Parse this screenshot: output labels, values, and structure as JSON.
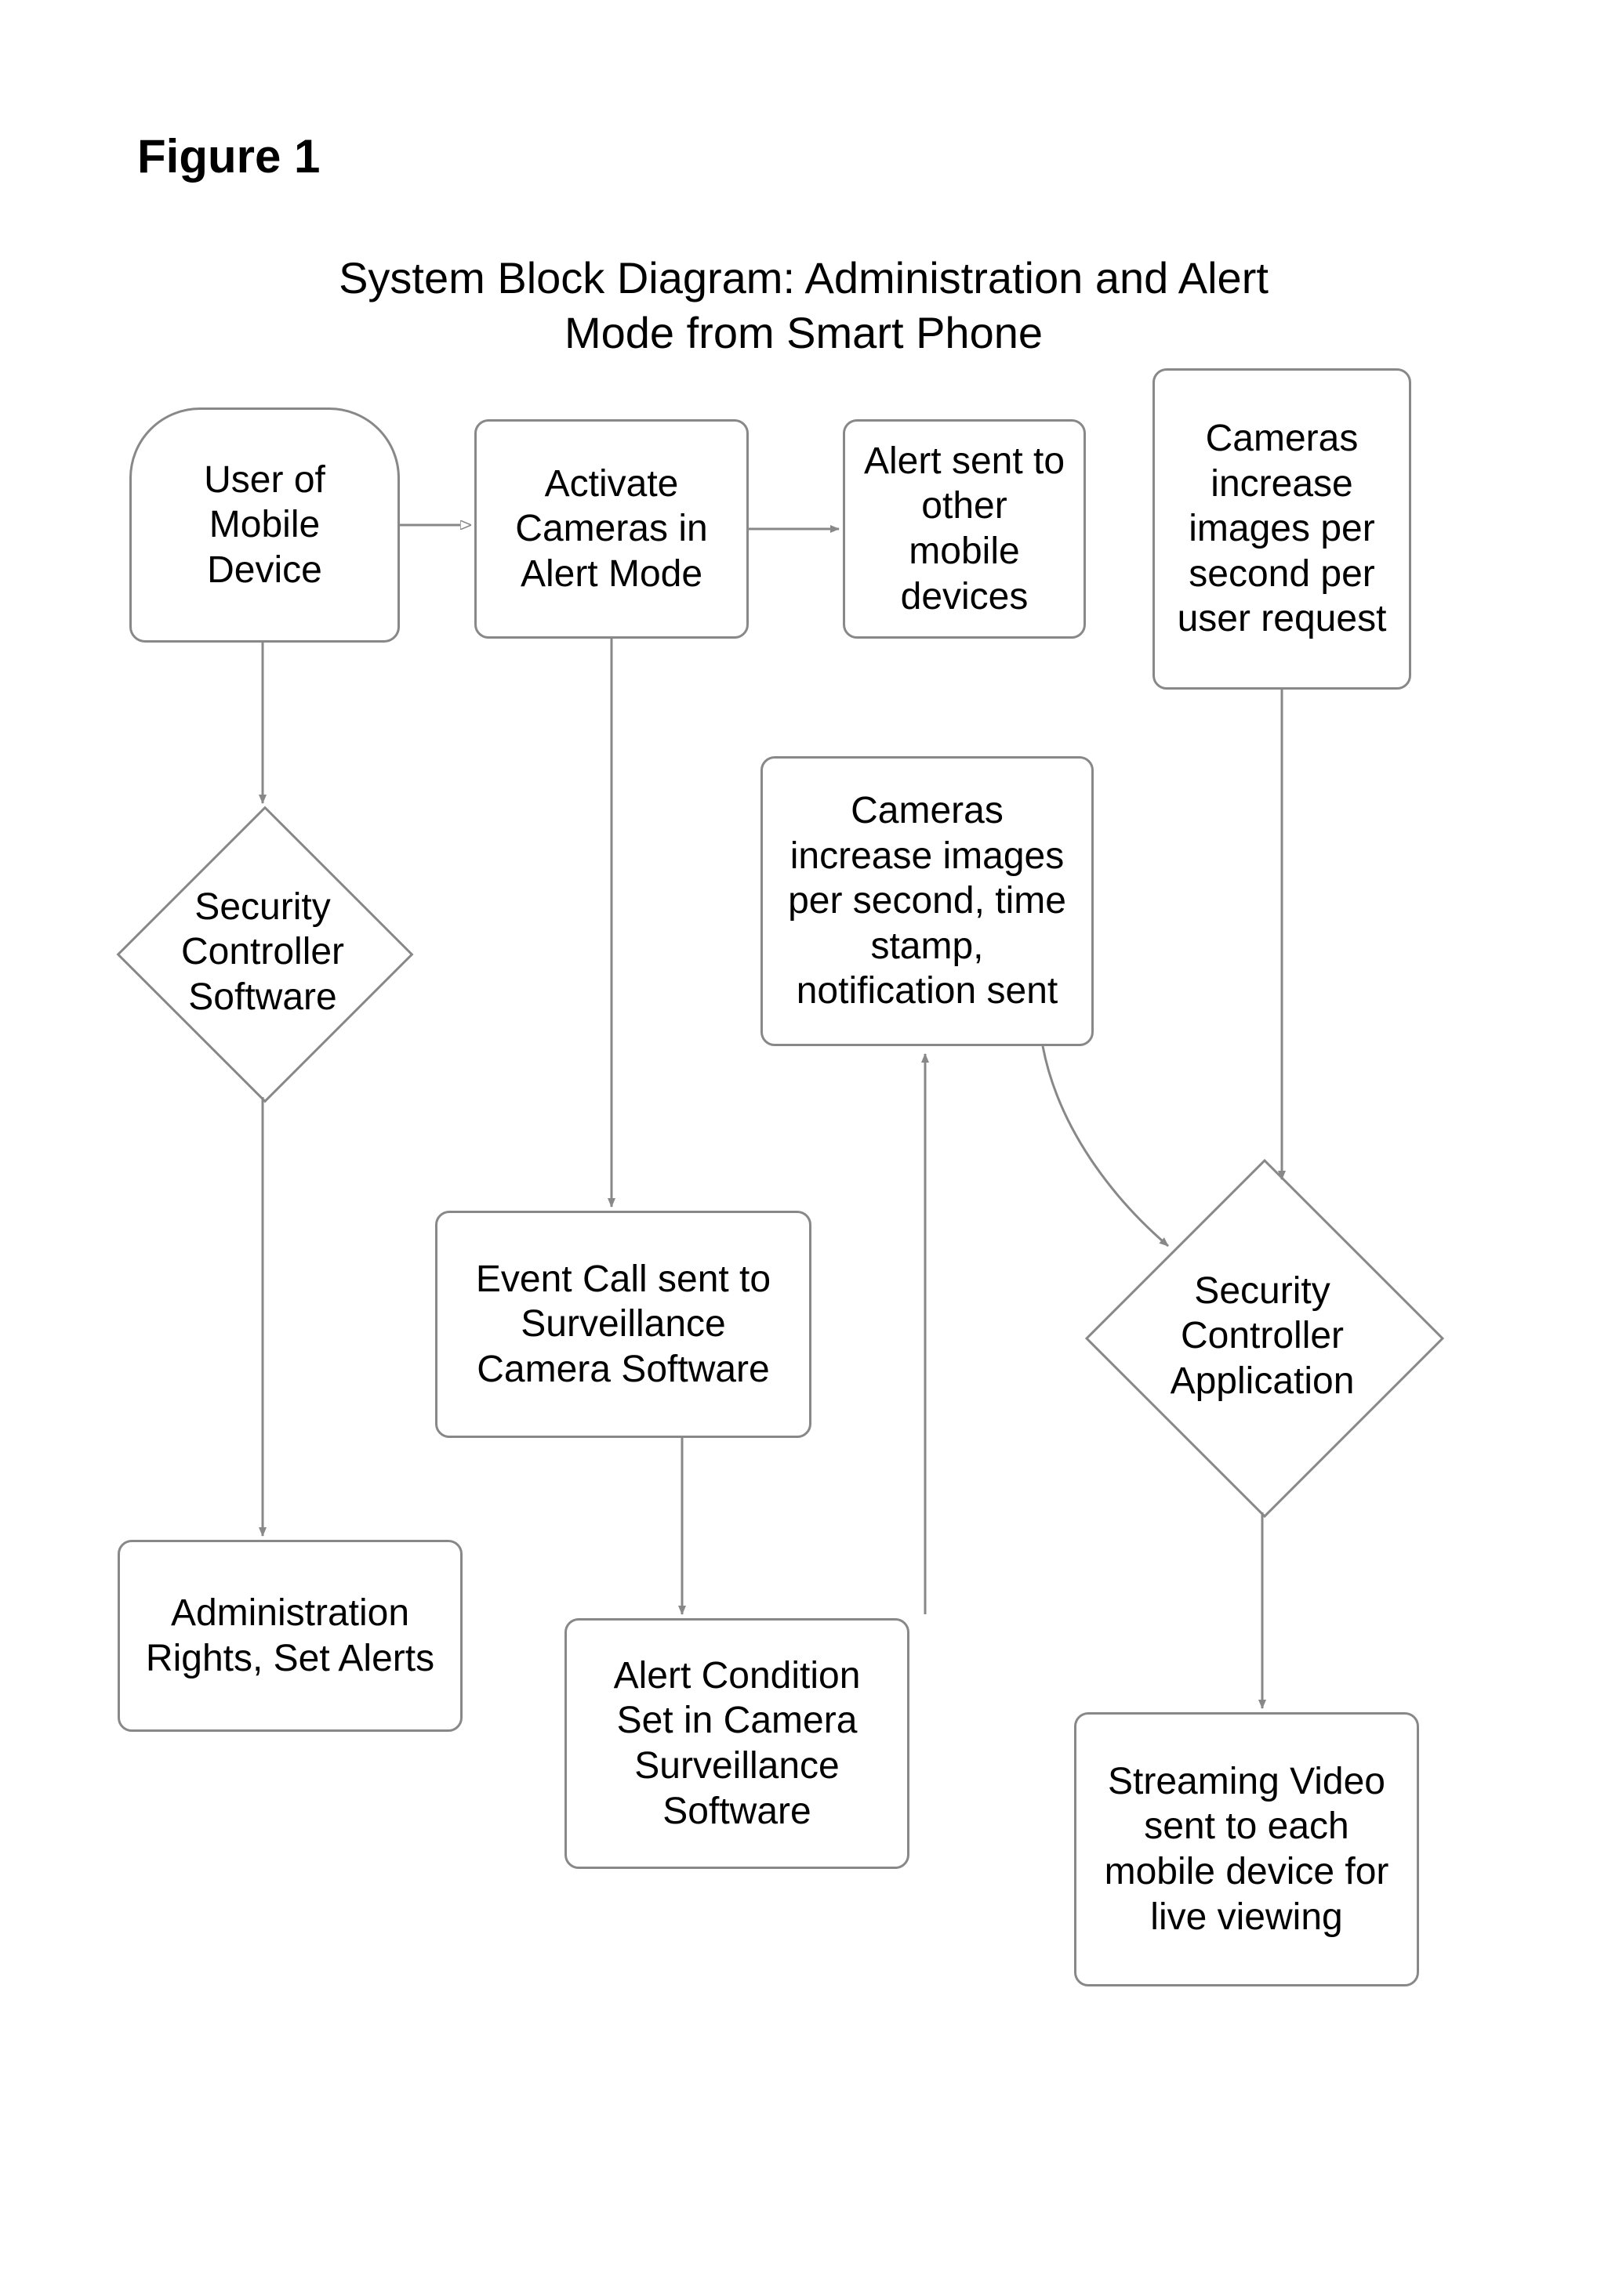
{
  "figure_label": "Figure 1",
  "title_line1": "System Block Diagram:  Administration and Alert",
  "title_line2": "Mode from Smart Phone",
  "nodes": {
    "user": "User of Mobile Device",
    "activate": "Activate Cameras in Alert Mode",
    "alert_sent": "Alert sent to other mobile devices",
    "cameras_increase_user": "Cameras increase images per second per user request",
    "security_software": "Security Controller Software",
    "cameras_increase_notify": "Cameras increase images per second, time stamp, notification sent",
    "event_call": "Event Call sent to Surveillance Camera Software",
    "security_app": "Security Controller Application",
    "admin_rights": "Administration Rights, Set Alerts",
    "alert_condition": "Alert Condition Set in Camera Surveillance Software",
    "streaming": "Streaming Video sent to each mobile device for live viewing"
  },
  "edges": [
    {
      "from": "user",
      "to": "activate"
    },
    {
      "from": "activate",
      "to": "alert_sent"
    },
    {
      "from": "user",
      "to": "security_software"
    },
    {
      "from": "security_software",
      "to": "admin_rights"
    },
    {
      "from": "activate",
      "to": "event_call"
    },
    {
      "from": "event_call",
      "to": "alert_condition"
    },
    {
      "from": "alert_condition",
      "to": "cameras_increase_notify"
    },
    {
      "from": "cameras_increase_notify",
      "to": "security_app"
    },
    {
      "from": "cameras_increase_user",
      "to": "security_app"
    },
    {
      "from": "security_app",
      "to": "streaming"
    }
  ]
}
